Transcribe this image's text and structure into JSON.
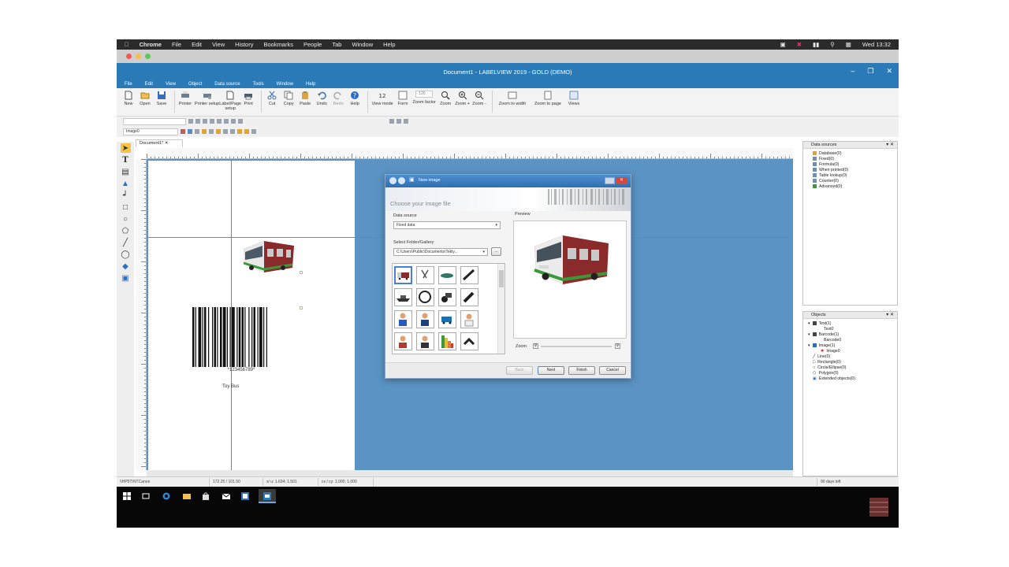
{
  "mac_menu": {
    "items": [
      "Chrome",
      "File",
      "Edit",
      "View",
      "History",
      "Bookmarks",
      "People",
      "Tab",
      "Window",
      "Help"
    ],
    "clock": "Wed 13:32"
  },
  "app": {
    "title": "Document1 - LABELVIEW 2019 - GOLD (DEMO)",
    "menu": [
      "File",
      "Edit",
      "View",
      "Object",
      "Data source",
      "Tools",
      "Window",
      "Help"
    ]
  },
  "ribbon": {
    "buttons": [
      {
        "label": "New"
      },
      {
        "label": "Open"
      },
      {
        "label": "Save"
      },
      {
        "label": "Printer"
      },
      {
        "label": "Printer setup"
      },
      {
        "label": "Label/Page setup"
      },
      {
        "label": "Print"
      },
      {
        "label": "Cut"
      },
      {
        "label": "Copy"
      },
      {
        "label": "Paste"
      },
      {
        "label": "Undo"
      },
      {
        "label": "Redo"
      },
      {
        "label": "Help"
      },
      {
        "label": "View mode"
      },
      {
        "label": "Form"
      },
      {
        "label": "Zoom factor"
      },
      {
        "label": "Zoom"
      },
      {
        "label": "Zoom +"
      },
      {
        "label": "Zoom -"
      },
      {
        "label": "Zoom to width"
      },
      {
        "label": "Zoom to page"
      },
      {
        "label": "Views"
      }
    ],
    "zoom_value": "120"
  },
  "toolbar": {
    "object_selector": "Image0"
  },
  "document_tab": "Document1*",
  "canvas": {
    "barcode_text": "*123456789*",
    "caption_text": "Toy Bus"
  },
  "data_sources": {
    "title": "Data sources",
    "items": [
      "Database(0)",
      "Fixed(0)",
      "Formula(0)",
      "When printed(0)",
      "Table lookup(0)",
      "Counter(0)",
      "Advanced(0)"
    ]
  },
  "objects": {
    "title": "Objects",
    "tree": [
      {
        "label": "Text(1)",
        "level": "top"
      },
      {
        "label": "Text0",
        "level": "sub"
      },
      {
        "label": "Barcode(1)",
        "level": "top"
      },
      {
        "label": "Barcode0",
        "level": "sub"
      },
      {
        "label": "Image(1)",
        "level": "top"
      },
      {
        "label": "Image0",
        "level": "sub"
      },
      {
        "label": "Line(0)",
        "level": "item"
      },
      {
        "label": "Rectangle(0)",
        "level": "item"
      },
      {
        "label": "Circle/Ellipse(0)",
        "level": "item"
      },
      {
        "label": "Polygon(0)",
        "level": "item"
      },
      {
        "label": "Extended objects(0)",
        "level": "item"
      }
    ]
  },
  "status": {
    "cells": [
      "\\\\HP5T\\NTCanon",
      "172.25 / 101.50",
      "x/ u: 1.634; 1.501",
      "cx / cy: 1.000; 1.000"
    ],
    "right": "90 days left"
  },
  "dialog": {
    "title": "New image",
    "heading": "Choose your image file",
    "data_source_label": "Data source",
    "data_source_value": "Fixed data",
    "folder_label": "Select Folder/Gallery",
    "folder_value": "C:\\Users\\Public\\Documents\\Tekly...",
    "browse_label": "...",
    "preview_label": "Preview",
    "zoom_label": "Zoom",
    "buttons": {
      "back": "Back",
      "next": "Next",
      "finish": "Finish",
      "cancel": "Cancel"
    }
  },
  "colors": {
    "app_blue": "#2a7ab8",
    "canvas_blue": "#5a93c4",
    "taskbar": "#070707"
  }
}
